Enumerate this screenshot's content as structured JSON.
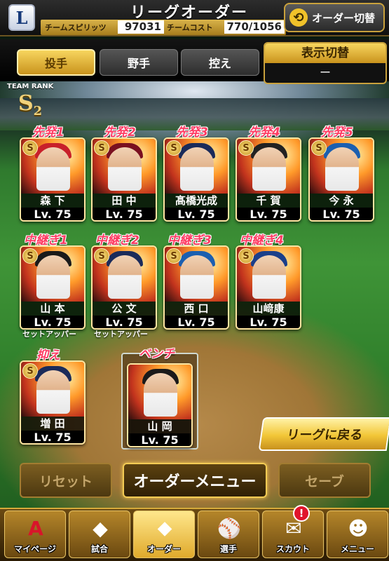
{
  "header": {
    "title": "リーグオーダー",
    "logo_letter": "L",
    "team_spirits_label": "チームスピリッツ",
    "team_spirits_value": "97031",
    "team_cost_label": "チームコスト",
    "team_cost_value": "770/1056",
    "order_switch_label": "オーダー切替"
  },
  "tabs": [
    {
      "label": "投手",
      "active": true
    },
    {
      "label": "野手",
      "active": false
    },
    {
      "label": "控え",
      "active": false
    }
  ],
  "display_toggle": {
    "title": "表示切替",
    "value": "ー"
  },
  "team_rank": {
    "label": "TEAM RANK",
    "rank": "S",
    "sub": "2"
  },
  "rotation": [
    {
      "slot": "先発1",
      "name": "森 下",
      "level": "Lv. 75",
      "badge": "S",
      "accent": "#c8202a"
    },
    {
      "slot": "先発2",
      "name": "田 中",
      "level": "Lv. 75",
      "badge": "S",
      "accent": "#7a1020"
    },
    {
      "slot": "先発3",
      "name": "髙橋光成",
      "level": "Lv. 75",
      "badge": "S",
      "accent": "#1b2b5a"
    },
    {
      "slot": "先発4",
      "name": "千 賀",
      "level": "Lv. 75",
      "badge": "S",
      "accent": "#222222"
    },
    {
      "slot": "先発5",
      "name": "今 永",
      "level": "Lv. 75",
      "badge": "S",
      "accent": "#1b5fb0"
    }
  ],
  "bullpen": [
    {
      "slot": "中継ぎ1",
      "name": "山 本",
      "level": "Lv. 75",
      "badge": "S",
      "accent": "#1a1a1a",
      "role": "セットアッパー"
    },
    {
      "slot": "中継ぎ2",
      "name": "公 文",
      "level": "Lv. 75",
      "badge": "S",
      "accent": "#1b2b5a",
      "role": "セットアッパー"
    },
    {
      "slot": "中継ぎ3",
      "name": "西 口",
      "level": "Lv. 75",
      "badge": "S",
      "accent": "#1b5fb0",
      "role": ""
    },
    {
      "slot": "中継ぎ4",
      "name": "山﨑康",
      "level": "Lv. 75",
      "badge": "S",
      "accent": "#1b3f8a",
      "role": ""
    }
  ],
  "closer": {
    "slot": "抑え",
    "name": "増 田",
    "level": "Lv. 75",
    "badge": "S",
    "accent": "#1b2b5a"
  },
  "bench": {
    "slot": "ベンチ",
    "name": "山 岡",
    "level": "Lv. 75",
    "badge": "",
    "accent": "#1a1a1a"
  },
  "buttons": {
    "league_back": "リーグに戻る",
    "reset": "リセット",
    "order_menu": "オーダーメニュー",
    "save": "セーブ"
  },
  "nav": [
    {
      "label": "マイページ",
      "icon": "A",
      "icon_name": "mypage-icon",
      "current": false
    },
    {
      "label": "試合",
      "icon": "◆",
      "icon_name": "stadium-icon",
      "current": false
    },
    {
      "label": "オーダー",
      "icon": "⬥",
      "icon_name": "field-icon",
      "current": true
    },
    {
      "label": "選手",
      "icon": "⚾",
      "icon_name": "player-icon",
      "current": false
    },
    {
      "label": "スカウト",
      "icon": "✉",
      "icon_name": "scout-icon",
      "current": false
    },
    {
      "label": "メニュー",
      "icon": "☻",
      "icon_name": "menu-icon",
      "current": false
    }
  ],
  "notification_count": "!"
}
